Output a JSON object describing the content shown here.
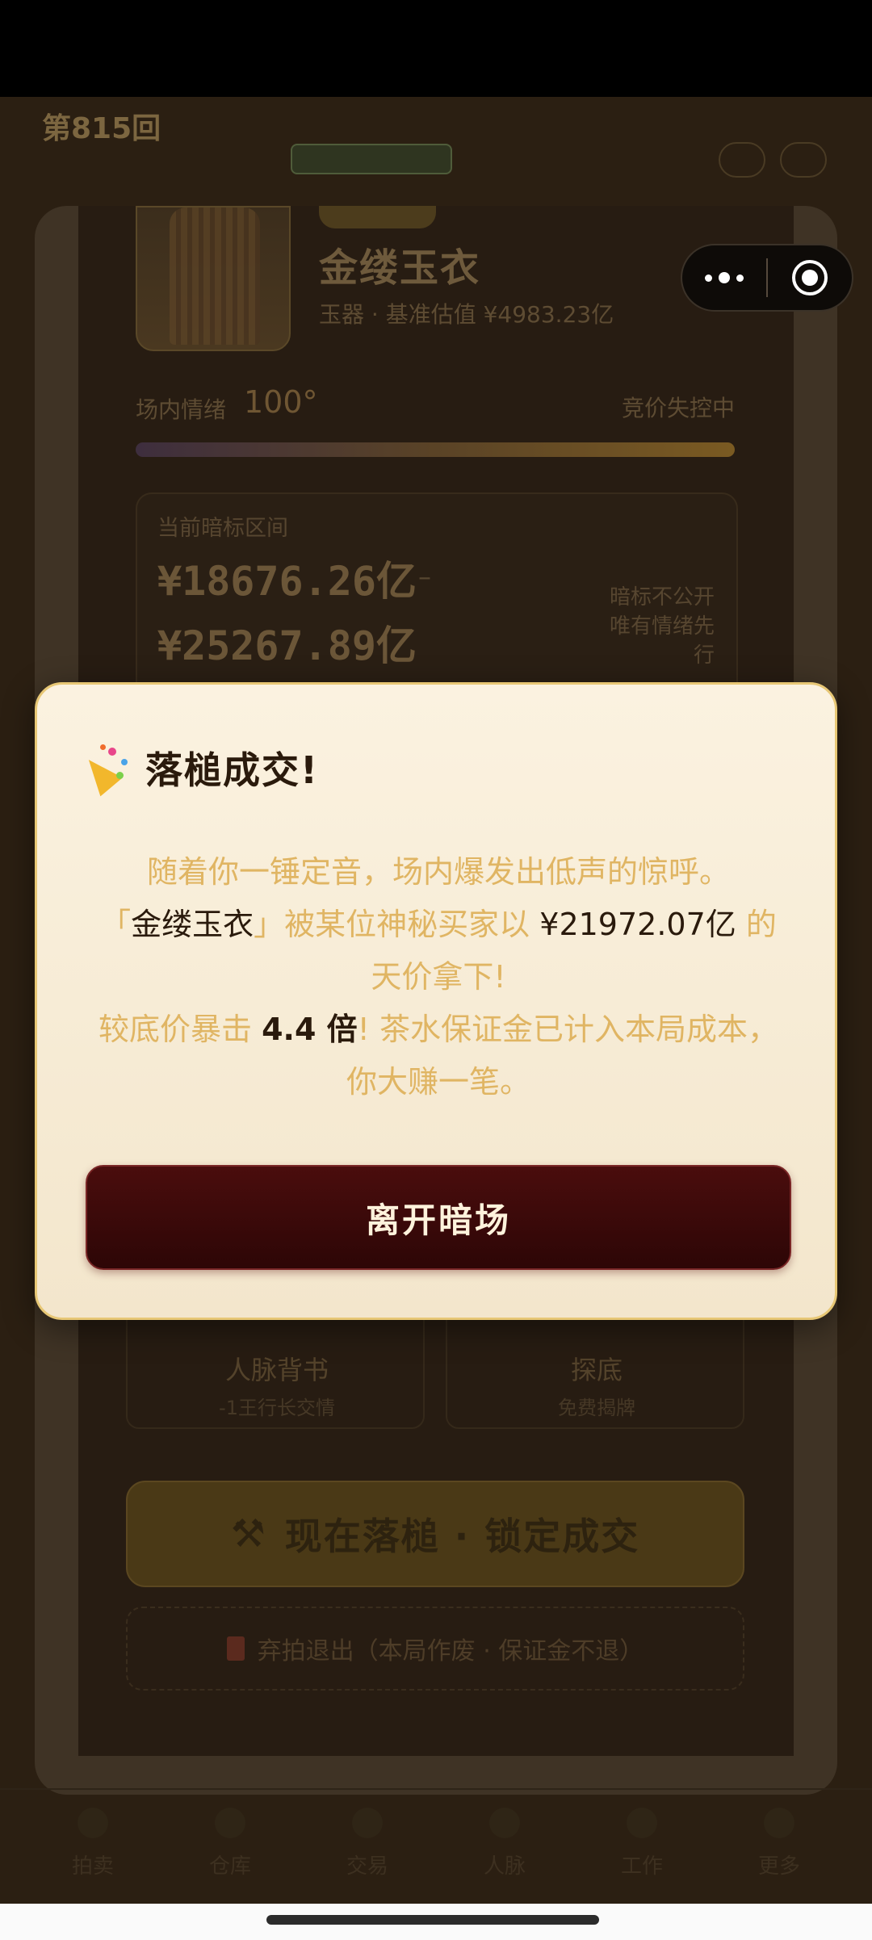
{
  "background": {
    "header": {
      "round_title": "第815回",
      "round_sub": "",
      "info_line": ""
    },
    "item": {
      "name": "金缕玉衣",
      "subtitle": "玉器 · 基准估值 ¥4983.23亿"
    },
    "mood": {
      "label": "场内情绪",
      "value": "100°",
      "state": "竞价失控中",
      "level_percent": 100
    },
    "bid_range": {
      "label": "当前暗标区间",
      "low": "¥18676.26亿",
      "dash": "–",
      "high": "¥25267.89亿",
      "note": "暗标不公开 唯有情绪先行"
    },
    "skills": [
      {
        "title": "人脉背书",
        "sub": "-1王行长交情"
      },
      {
        "title": "探底",
        "sub": "免费揭牌"
      }
    ],
    "gavel_button": {
      "label": "现在落槌 · 锁定成交",
      "icon": "hammer-icon"
    },
    "quit_button": {
      "label": "弃拍退出（本局作废 · 保证金不退）",
      "icon": "door-icon"
    },
    "tabs": [
      {
        "label": "拍卖"
      },
      {
        "label": "仓库"
      },
      {
        "label": "交易"
      },
      {
        "label": "人脉"
      },
      {
        "label": "工作"
      },
      {
        "label": "更多"
      }
    ]
  },
  "capsule": {
    "more_icon": "more-dots-icon",
    "close_icon": "target-icon"
  },
  "modal": {
    "icon": "party-popper-icon",
    "title": "落槌成交!",
    "line1": "随着你一锤定音，场内爆发出低声的惊呼。",
    "quote_open": "「",
    "item_name": "金缕玉衣",
    "quote_close": "」被某位神秘买家以",
    "price": "¥21972.07亿",
    "tail1": "的",
    "line3": "天价拿下!",
    "line4_pre": "较底价暴击",
    "multiplier": "4.4 倍",
    "line4_post": "! 茶水保证金已计入本局成本，你大赚一笔。",
    "button_label": "离开暗场"
  },
  "colors": {
    "modal_bg": "#fbf2e0",
    "modal_border": "#e7c775",
    "body_text": "#e0b563",
    "button_bg": "#3a0909",
    "button_text": "#fff3dc"
  }
}
